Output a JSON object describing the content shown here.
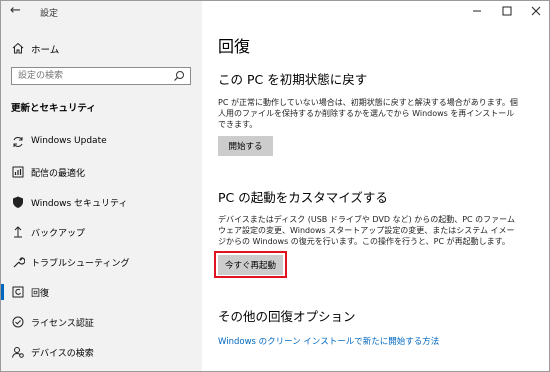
{
  "app": {
    "title": "設定"
  },
  "sidebar": {
    "home_label": "ホーム",
    "search_placeholder": "設定の検索",
    "section_title": "更新とセキュリティ",
    "items": [
      {
        "label": "Windows Update",
        "icon": "sync-icon"
      },
      {
        "label": "配信の最適化",
        "icon": "delivery-optimization-icon"
      },
      {
        "label": "Windows セキュリティ",
        "icon": "shield-icon"
      },
      {
        "label": "バックアップ",
        "icon": "backup-arrow-icon"
      },
      {
        "label": "トラブルシューティング",
        "icon": "wrench-icon"
      },
      {
        "label": "回復",
        "icon": "recovery-icon",
        "selected": true
      },
      {
        "label": "ライセンス認証",
        "icon": "check-circle-icon"
      },
      {
        "label": "デバイスの検索",
        "icon": "person-pin-icon"
      }
    ]
  },
  "main": {
    "page_title": "回復",
    "reset": {
      "heading": "この PC を初期状態に戻す",
      "description": "PC が正常に動作していない場合は、初期状態に戻すと解決する場合があります。個人用のファイルを保持するか削除するかを選んでから Windows を再インストールできます。",
      "button": "開始する"
    },
    "advanced": {
      "heading": "PC の起動をカスタマイズする",
      "description": "デバイスまたはディスク (USB ドライブや DVD など) からの起動、PC のファームウェア設定の変更、Windows スタートアップ設定の変更、またはシステム イメージからの Windows の復元を行います。この操作を行うと、PC が再起動します。",
      "button": "今すぐ再起動"
    },
    "more": {
      "heading": "その他の回復オプション",
      "link": "Windows のクリーン インストールで新たに開始する方法"
    }
  },
  "colors": {
    "accent": "#0067c0",
    "highlight_border": "#e0141e",
    "sidebar_bg": "#f2f2f2",
    "button_bg": "#cccccc"
  }
}
